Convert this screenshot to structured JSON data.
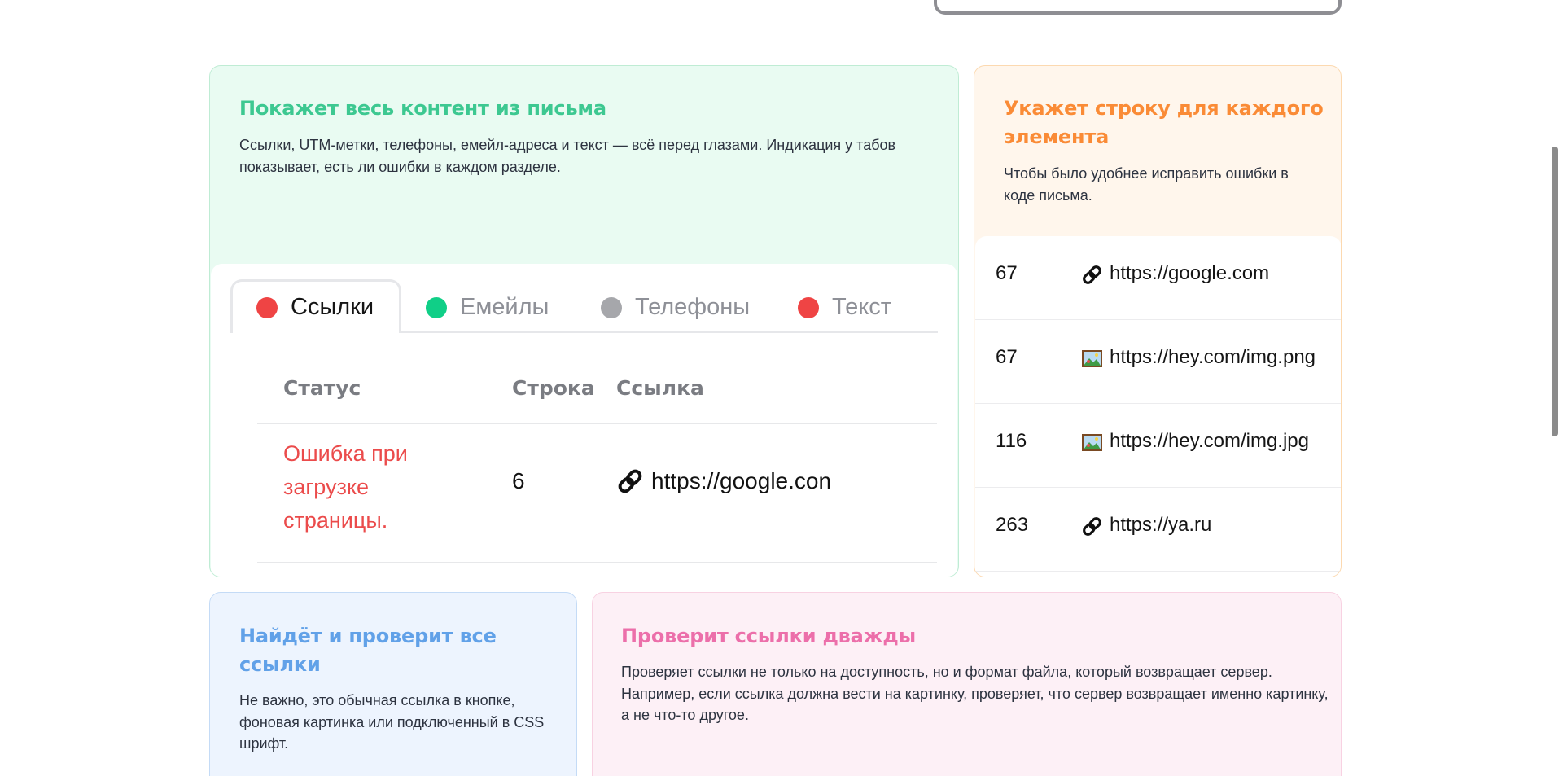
{
  "green_card": {
    "title": "Покажет весь контент из письма",
    "text": "Ссылки, UTM-метки, телефоны, емейл-адреса и текст — всё перед глазами. Индикация у табов показывает, есть ли ошибки в каждом разделе.",
    "tabs": [
      {
        "label": "Ссылки",
        "status_color": "#ef4444",
        "active": true
      },
      {
        "label": "Емейлы",
        "status_color": "#10cf87",
        "active": false
      },
      {
        "label": "Телефоны",
        "status_color": "#a6a7ab",
        "active": false
      },
      {
        "label": "Текст",
        "status_color": "#ef4444",
        "active": false
      }
    ],
    "table": {
      "headers": [
        "Статус",
        "Строка",
        "Ссылка"
      ],
      "rows": [
        {
          "status": "Ошибка при загрузке страницы.",
          "line": "6",
          "icon": "link-icon",
          "url": "https://google.con"
        }
      ]
    }
  },
  "orange_card": {
    "title": "Укажет строку для каждого элемента",
    "text": "Чтобы было удобнее исправить ошибки в коде письма.",
    "rows": [
      {
        "line": "67",
        "icon": "link-icon",
        "url": "https://google.com"
      },
      {
        "line": "67",
        "icon": "image-icon",
        "url": "https://hey.com/img.png"
      },
      {
        "line": "116",
        "icon": "image-icon",
        "url": "https://hey.com/img.jpg"
      },
      {
        "line": "263",
        "icon": "link-icon",
        "url": "https://ya.ru"
      }
    ]
  },
  "blue_card": {
    "title": "Найдёт и проверит все ссылки",
    "text": "Не важно, это обычная ссылка в кнопке, фоновая картинка или подключенный в CSS шрифт."
  },
  "pink_card": {
    "title": "Проверит ссылки дважды",
    "text": "Проверяет ссылки не только на доступность, но и формат файла, который возвращает сервер. Например, если ссылка должна вести на картинку, проверяет, что сервер возвращает именно картинку, а не что-то другое."
  }
}
